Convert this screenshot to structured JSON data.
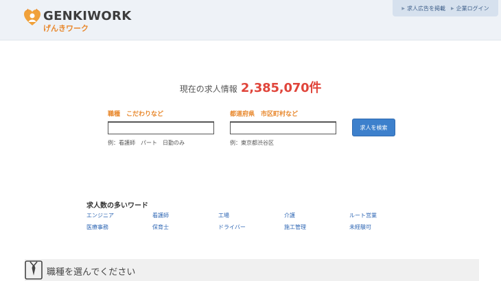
{
  "header": {
    "logo_en": "GENKIWORK",
    "logo_ja": "げんきワーク",
    "links": [
      {
        "label": "求人広告を掲載"
      },
      {
        "label": "企業ログイン"
      }
    ]
  },
  "count": {
    "label": "現在の求人情報",
    "value": "2,385,070件"
  },
  "search": {
    "keyword": {
      "label": "職種　こだわりなど",
      "value": "",
      "example": "例：看護師　パート　日勤のみ"
    },
    "location": {
      "label": "都道府県　市区町村など",
      "value": "",
      "example": "例：東京都渋谷区"
    },
    "button_label": "求人を検索"
  },
  "popular": {
    "title": "求人数の多いワード",
    "words": [
      "エンジニア",
      "看護師",
      "工場",
      "介護",
      "ルート営業",
      "医療事務",
      "保育士",
      "ドライバー",
      "施工管理",
      "未経験可"
    ]
  },
  "job_select": {
    "title": "職種を選んでください"
  },
  "colors": {
    "accent_orange": "#e8882d",
    "count_red": "#e0453b",
    "button_blue": "#3d80cc",
    "link_blue": "#2f67b4"
  }
}
